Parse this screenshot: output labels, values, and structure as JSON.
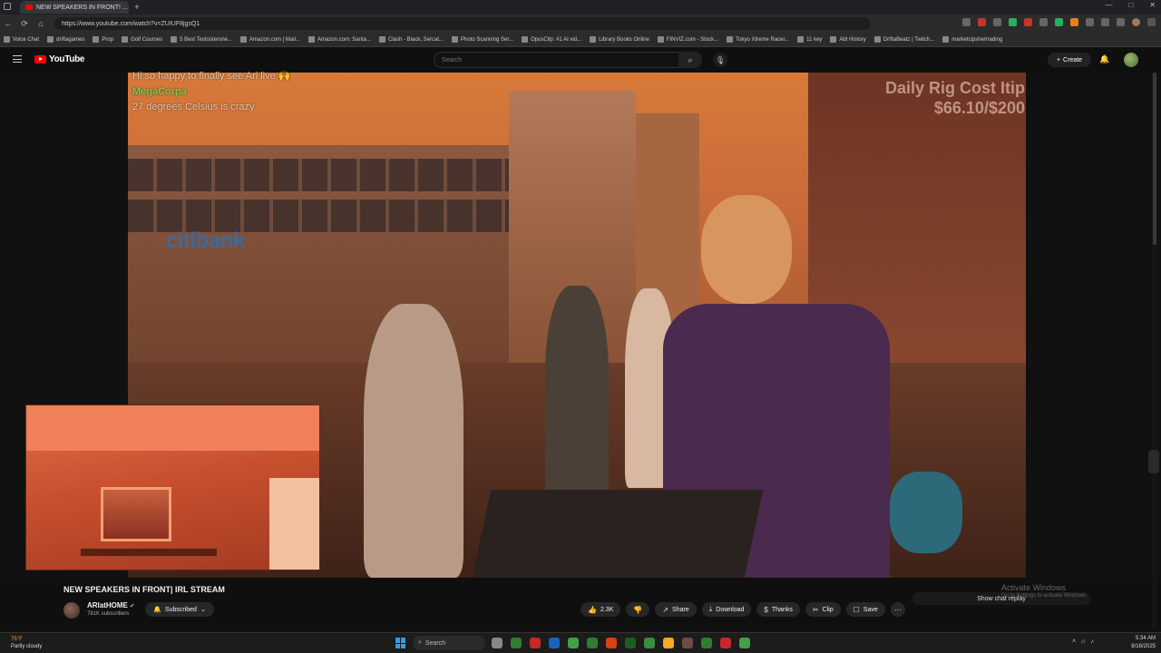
{
  "browser": {
    "tab_title": "NEW SPEAKERS IN FRONT! ...",
    "new_tab_symbol": "+",
    "window_controls": [
      "—",
      "□",
      "✕"
    ],
    "url": "https://www.youtube.com/watch?v=ZUIUF8jgsQ1"
  },
  "bookmarks": [
    "Voice Chat",
    "driftagames",
    "Prop",
    "Golf Courses",
    "5 Best Testosterone...",
    "Amazon.com | Mail...",
    "Amazon.com: Santa...",
    "Clash - Black, Sercat...",
    "Photo Scanning Ser...",
    "OpusClip: #1 AI vid...",
    "Library Books Online",
    "FINVIZ.com - Stock...",
    "Tokyo Xtreme Racer...",
    "11 key",
    "Abt History",
    "DriftaBeatz | Twitch...",
    "marketcipshertrading"
  ],
  "youtube": {
    "logo_text": "YouTube",
    "search_placeholder": "Search",
    "create_label": "Create"
  },
  "chat": [
    {
      "user": "",
      "message": "Hi so happy to finally see Ari live 🙌"
    },
    {
      "user": "MegaCorpa",
      "message": ""
    },
    {
      "user": "",
      "message": "27 degrees Celsius is crazy"
    }
  ],
  "overlay": {
    "rig_title": "Daily Rig Cost Itip",
    "rig_value": "$66.10/$200"
  },
  "video_scene": {
    "sign_text": "citibank"
  },
  "video_info": {
    "title": "NEW SPEAKERS IN FRONT| IRL STREAM",
    "channel": "ARIatHOME",
    "subscribers": "781K subscribers",
    "subscribed_label": "Subscribed",
    "like_count": "2.3K",
    "share_label": "Share",
    "download_label": "Download",
    "thanks_label": "Thanks",
    "clip_label": "Clip",
    "save_label": "Save",
    "show_chat_label": "Show chat replay"
  },
  "watermark": {
    "title": "Activate Windows",
    "subtitle": "Go to Settings to activate Windows."
  },
  "taskbar": {
    "temperature": "75°F",
    "weather": "Partly cloudy",
    "search_placeholder": "Search",
    "time": "5:34 AM",
    "date": "8/16/2025"
  },
  "colors": {
    "youtube_red": "#ff0000",
    "chat_green": "#6fcf4f",
    "chat_red": "#d84a2a"
  }
}
